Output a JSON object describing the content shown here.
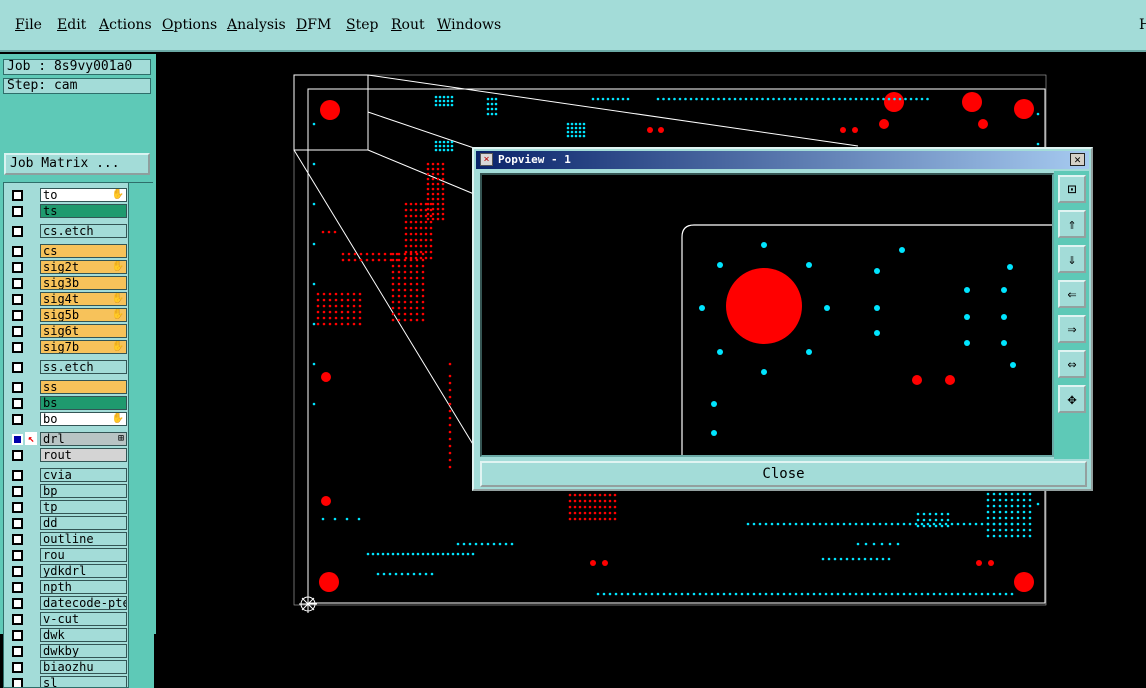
{
  "menubar": {
    "items": [
      "File",
      "Edit",
      "Actions",
      "Options",
      "Analysis",
      "DFM",
      "Step",
      "Rout",
      "Windows"
    ],
    "right_label": "H"
  },
  "job": {
    "job_line": "Job : 8s9vy001a0",
    "step_line": "Step: cam",
    "matrix_button": "Job Matrix ..."
  },
  "layers": [
    {
      "name": "to",
      "color": "#ffffff",
      "marker": "hand"
    },
    {
      "name": "ts",
      "color": "#1f9a6e",
      "marker": ""
    },
    {
      "name": "cs.etch",
      "color": "#a3dcd8",
      "marker": ""
    },
    {
      "name": "cs",
      "color": "#f7c25a",
      "marker": ""
    },
    {
      "name": "sig2t",
      "color": "#f7c25a",
      "marker": "hand"
    },
    {
      "name": "sig3b",
      "color": "#f7c25a",
      "marker": ""
    },
    {
      "name": "sig4t",
      "color": "#f7c25a",
      "marker": "hand"
    },
    {
      "name": "sig5b",
      "color": "#f7c25a",
      "marker": "hand"
    },
    {
      "name": "sig6t",
      "color": "#f7c25a",
      "marker": ""
    },
    {
      "name": "sig7b",
      "color": "#f7c25a",
      "marker": "hand"
    },
    {
      "name": "ss.etch",
      "color": "#a3dcd8",
      "marker": ""
    },
    {
      "name": "ss",
      "color": "#f7c25a",
      "marker": ""
    },
    {
      "name": "bs",
      "color": "#1f9a6e",
      "marker": ""
    },
    {
      "name": "bo",
      "color": "#ffffff",
      "marker": "hand"
    },
    {
      "name": "drl",
      "color": "#b8c4c4",
      "marker": "box",
      "active": true
    },
    {
      "name": "rout",
      "color": "#d4d4d4",
      "marker": ""
    },
    {
      "name": "cvia",
      "color": "#a3dcd8",
      "marker": ""
    },
    {
      "name": "bp",
      "color": "#a3dcd8",
      "marker": ""
    },
    {
      "name": "tp",
      "color": "#a3dcd8",
      "marker": ""
    },
    {
      "name": "dd",
      "color": "#a3dcd8",
      "marker": ""
    },
    {
      "name": "outline",
      "color": "#a3dcd8",
      "marker": ""
    },
    {
      "name": "rou",
      "color": "#a3dcd8",
      "marker": ""
    },
    {
      "name": "ydkdrl",
      "color": "#a3dcd8",
      "marker": ""
    },
    {
      "name": "npth",
      "color": "#a3dcd8",
      "marker": ""
    },
    {
      "name": "datecode-pte",
      "color": "#a3dcd8",
      "marker": ""
    },
    {
      "name": "v-cut",
      "color": "#a3dcd8",
      "marker": ""
    },
    {
      "name": "dwk",
      "color": "#a3dcd8",
      "marker": ""
    },
    {
      "name": "dwkby",
      "color": "#a3dcd8",
      "marker": ""
    },
    {
      "name": "biaozhu",
      "color": "#a3dcd8",
      "marker": ""
    },
    {
      "name": "sl",
      "color": "#a3dcd8",
      "marker": ""
    }
  ],
  "popview": {
    "title": "Popview - 1",
    "close_label": "Close",
    "tools": [
      "zoom-fit-icon",
      "pan-up-icon",
      "pan-down-icon",
      "pan-left-icon",
      "pan-right-icon",
      "zoom-in-icon",
      "zoom-out-icon"
    ]
  },
  "colors": {
    "pad": "#ff0000",
    "via": "#00e5ff",
    "outline": "#ffffff",
    "panel": "#a3dcd8"
  }
}
